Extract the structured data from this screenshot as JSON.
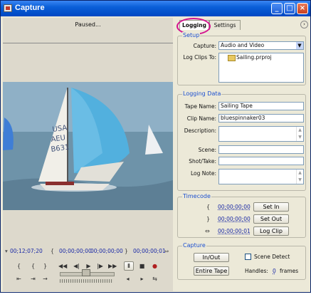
{
  "window": {
    "title": "Capture",
    "min": "_",
    "max": "□",
    "close": "×"
  },
  "monitor": {
    "status": "Paused...",
    "timecode": "00;12;07;20",
    "in_point": "00;00;00;00",
    "out_point": "00;00;00;00",
    "duration": "00;00;00;01"
  },
  "tabs": {
    "logging": "Logging",
    "settings": "Settings"
  },
  "setup": {
    "header": "Setup",
    "capture_label": "Capture:",
    "capture_value": "Audio and Video",
    "logclips_label": "Log Clips To:",
    "logclips_value": "Sailing.prproj"
  },
  "logging_data": {
    "header": "Logging Data",
    "tape_label": "Tape Name:",
    "tape_value": "Sailing Tape",
    "clip_label": "Clip Name:",
    "clip_value": "bluespinnaker03",
    "description_label": "Description:",
    "scene_label": "Scene:",
    "shot_label": "Shot/Take:",
    "lognote_label": "Log Note:"
  },
  "timecode": {
    "header": "Timecode",
    "in_value": "00;00;00;00",
    "out_value": "00;00;00;00",
    "dur_value": "00;00;00;01",
    "set_in": "Set In",
    "set_out": "Set Out",
    "log_clip": "Log Clip"
  },
  "capture": {
    "header": "Capture",
    "inout": "In/Out",
    "entire_tape": "Entire Tape",
    "scene_detect": "Scene Detect",
    "handles_label": "Handles:",
    "handles_value": "0",
    "frames": "frames"
  },
  "colors": {
    "accent": "#1b4fd0",
    "highlight": "#d4148f",
    "titlebar": "#0a5fd8"
  }
}
